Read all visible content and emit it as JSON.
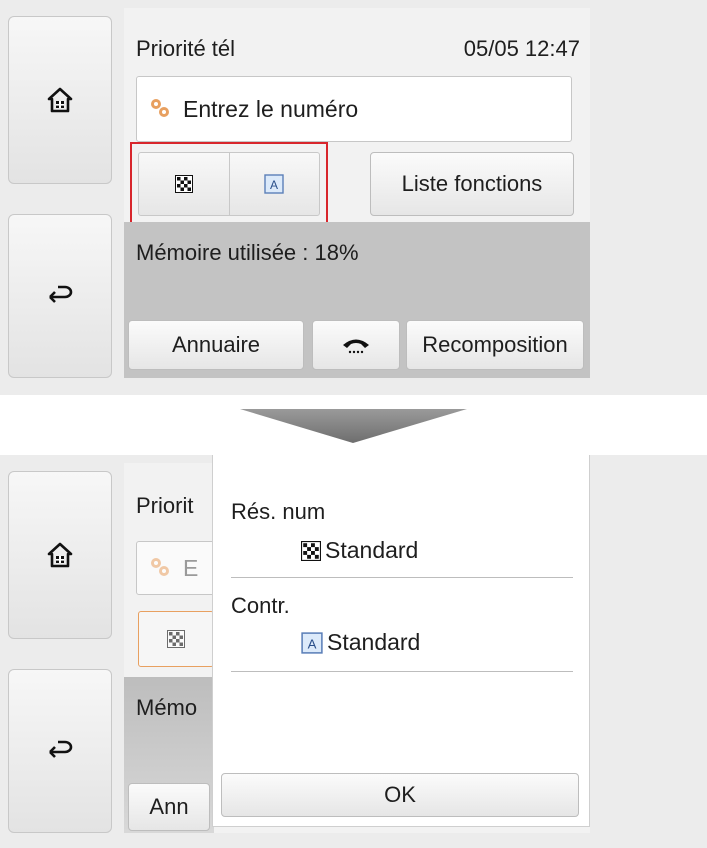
{
  "screen_before": {
    "header": {
      "title": "Priorité tél",
      "datetime": "05/05 12:47"
    },
    "number_field": {
      "placeholder": "Entrez le numéro",
      "icon": "key-icon"
    },
    "settings_toggle": {
      "resolution_icon": "checker-icon",
      "contrast_icon": "contrast-a-icon"
    },
    "function_list_label": "Liste fonctions",
    "memory_label": "Mémoire utilisée : 18%",
    "bottom_buttons": {
      "directory": "Annuaire",
      "hook_icon": "phone-hook-icon",
      "redial": "Recomposition"
    },
    "nav": {
      "home_icon": "home-icon",
      "back_icon": "back-icon"
    }
  },
  "screen_after": {
    "background_fragments": {
      "title": "Priorit",
      "field": "E",
      "memory": "Mémo",
      "directory": "Ann"
    },
    "popup": {
      "resolution_label": "Rés. num",
      "resolution_value": "Standard",
      "contrast_label": "Contr.",
      "contrast_value": "Standard",
      "ok_label": "OK"
    }
  },
  "colors": {
    "highlight": "#d8262c",
    "accent_orange": "#e8a060",
    "screen_bg": "#ececec",
    "panel_grey": "#c3c3c3"
  }
}
